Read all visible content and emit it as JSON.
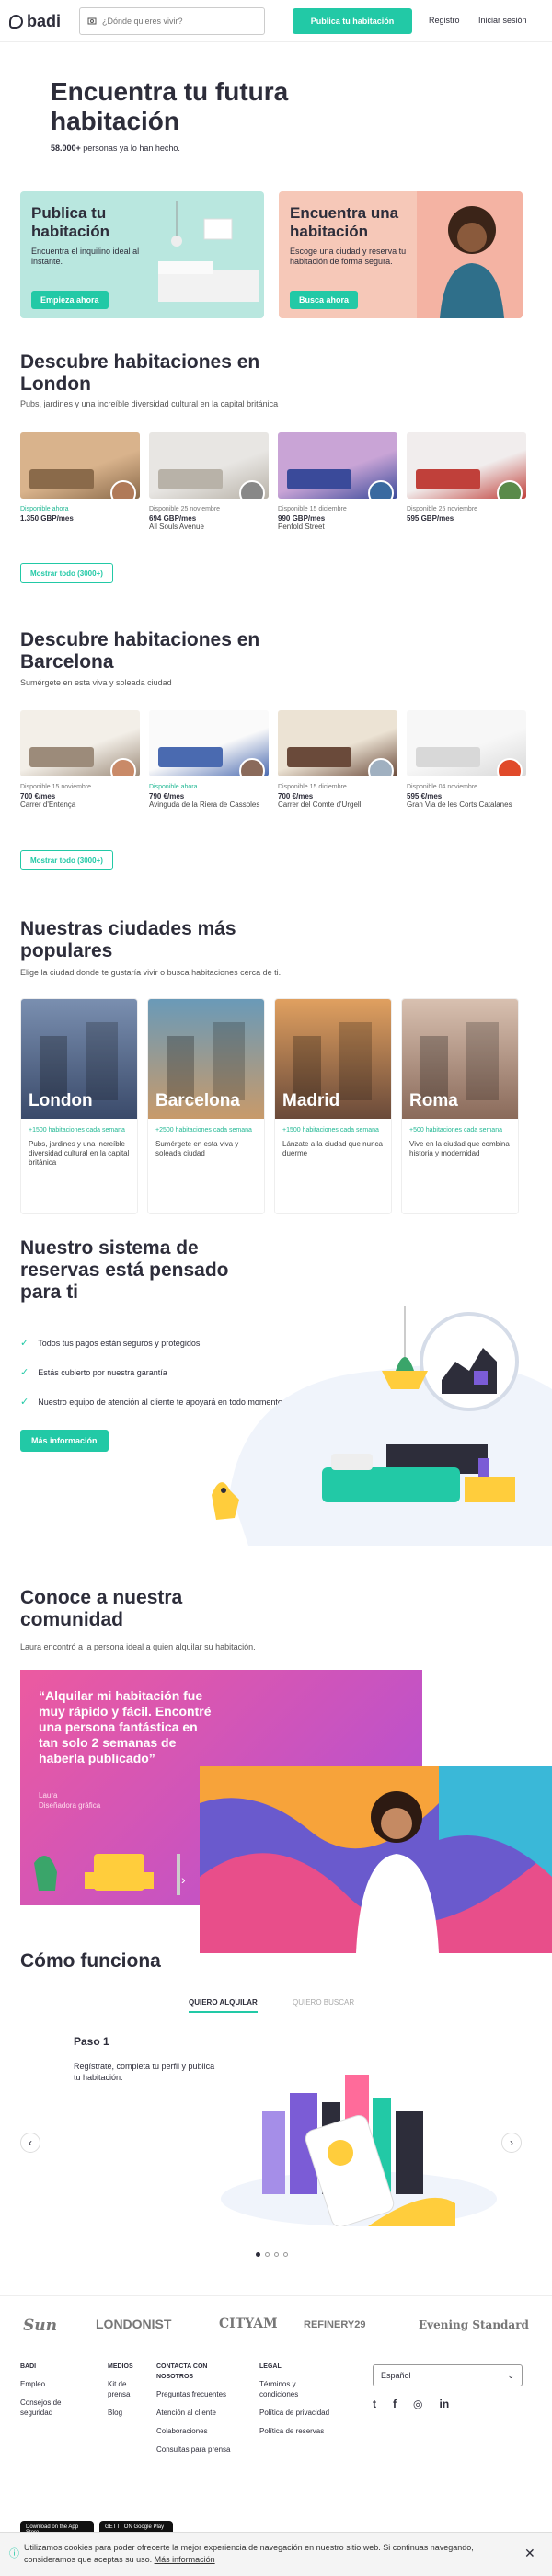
{
  "header": {
    "logo": "badi",
    "search_placeholder": "¿Dónde quieres vivir?",
    "publish": "Publica tu habitación",
    "register": "Registro",
    "login": "Iniciar sesión"
  },
  "hero": {
    "title": "Encuentra tu futura habitación",
    "count": "58.000+",
    "count_rest": " personas ya lo han hecho."
  },
  "cards": [
    {
      "title": "Publica tu habitación",
      "text": "Encuentra el inquilino ideal al instante.",
      "button": "Empieza ahora",
      "bg": "#b9e7df"
    },
    {
      "title": "Encuentra una habitación",
      "text": "Escoge una ciudad y reserva tu habitación de forma segura.",
      "button": "Busca ahora",
      "bg": "#f6c8b8"
    }
  ],
  "london": {
    "title": "Descubre habitaciones en London",
    "sub": "Pubs, jardines y una increíble diversidad cultural en la capital británica",
    "show_all": "Mostrar todo (3000+)",
    "items": [
      {
        "date": "Disponible ahora",
        "price": "1.350 GBP/mes",
        "street": ""
      },
      {
        "date": "Disponible 25 noviembre",
        "price": "694 GBP/mes",
        "street": "All Souls Avenue"
      },
      {
        "date": "Disponible 15 diciembre",
        "price": "990 GBP/mes",
        "street": "Penfold Street"
      },
      {
        "date": "Disponible 25 noviembre",
        "price": "595 GBP/mes",
        "street": ""
      }
    ]
  },
  "barcelona": {
    "title": "Descubre habitaciones en Barcelona",
    "sub": "Sumérgete en esta viva y soleada ciudad",
    "show_all": "Mostrar todo (3000+)",
    "items": [
      {
        "date": "Disponible 15 noviembre",
        "price": "700 €/mes",
        "street": "Carrer d'Entença"
      },
      {
        "date": "Disponible ahora",
        "price": "790 €/mes",
        "street": "Avinguda de la Riera de Cassoles"
      },
      {
        "date": "Disponible 15 diciembre",
        "price": "700 €/mes",
        "street": "Carrer del Comte d'Urgell"
      },
      {
        "date": "Disponible 04 noviembre",
        "price": "595 €/mes",
        "street": "Gran Via de les Corts Catalanes"
      }
    ]
  },
  "cities": {
    "title": "Nuestras ciudades más populares",
    "sub": "Elige la ciudad donde te gustaría vivir o busca habitaciones cerca de ti.",
    "items": [
      {
        "name": "London",
        "count": "+1500 habitaciones cada semana",
        "desc": "Pubs, jardines y una increíble diversidad cultural en la capital británica"
      },
      {
        "name": "Barcelona",
        "count": "+2500 habitaciones cada semana",
        "desc": "Sumérgete en esta viva y soleada ciudad"
      },
      {
        "name": "Madrid",
        "count": "+1500 habitaciones cada semana",
        "desc": "Lánzate a la ciudad que nunca duerme"
      },
      {
        "name": "Roma",
        "count": "+500 habitaciones cada semana",
        "desc": "Vive en la ciudad que combina historia y modernidad"
      }
    ]
  },
  "booking": {
    "title": "Nuestro sistema de reservas está pensado para ti",
    "checks": [
      "Todos tus pagos están seguros y protegidos",
      "Estás cubierto por nuestra garantía",
      "Nuestro equipo de atención al cliente te apoyará en todo momento"
    ],
    "button": "Más información"
  },
  "community": {
    "title": "Conoce a nuestra comunidad",
    "sub": "Laura encontró a la persona ideal a quien alquilar su habitación.",
    "quote": "“Alquilar mi habitación fue muy rápido y fácil. Encontré una persona fantástica en tan solo 2 semanas de haberla publicado”",
    "name": "Laura",
    "role": "Diseñadora gráfica"
  },
  "how": {
    "title": "Cómo funciona",
    "tab1": "QUIERO ALQUILAR",
    "tab2": "QUIERO BUSCAR",
    "step": "Paso 1",
    "step_text": "Regístrate, completa tu perfil y publica tu habitación."
  },
  "press": [
    "Sun",
    "LONDONIST",
    "CITYAM",
    "REFINERY29",
    "Evening Standard"
  ],
  "footer": {
    "badi": {
      "h": "BADI",
      "items": [
        "Empleo",
        "Consejos de seguridad"
      ]
    },
    "media": {
      "h": "MEDIOS",
      "items": [
        "Kit de prensa",
        "Blog"
      ]
    },
    "contact": {
      "h": "CONTACTA CON NOSOTROS",
      "items": [
        "Preguntas frecuentes",
        "Atención al cliente",
        "Colaboraciones",
        "Consultas para prensa"
      ]
    },
    "legal": {
      "h": "LEGAL",
      "items": [
        "Términos y condiciones",
        "Política de privacidad",
        "Política de reservas"
      ]
    },
    "language": "Español",
    "app_store": "Download on the App Store",
    "google_play": "GET IT ON Google Play"
  },
  "cookie": {
    "text": "Utilizamos cookies para poder ofrecerte la mejor experiencia de navegación en nuestro sitio web. Si continuas navegando, consideramos que aceptas su uso. ",
    "link": "Más información"
  }
}
